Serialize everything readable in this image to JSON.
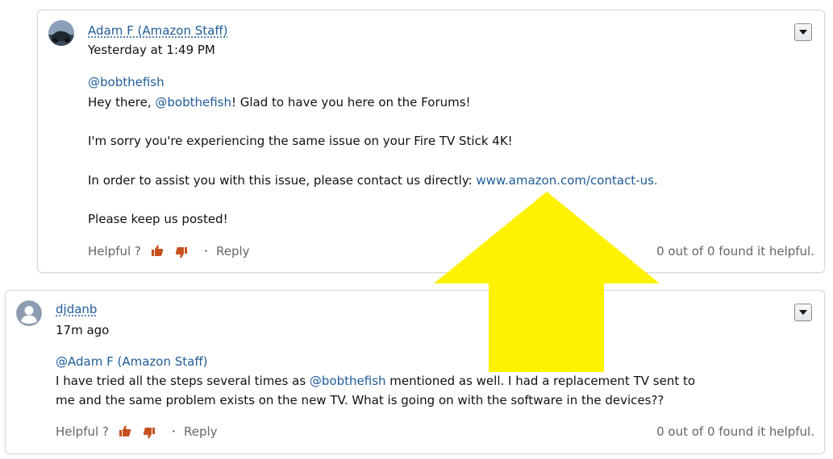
{
  "posts": [
    {
      "author": "Adam F (Amazon Staff)",
      "time": "Yesterday at 1:49 PM",
      "mention_line": "@bobthefish",
      "greeting_pre": "Hey there, ",
      "greeting_mention": "@bobthefish",
      "greeting_post": "! Glad to have you here on the Forums!",
      "sorry_line": "I'm sorry you're experiencing the same issue on your Fire TV Stick 4K!",
      "assist_pre": "In order to assist you with this issue, please contact us directly: ",
      "assist_link": "www.amazon.com/contact-us.",
      "closing": "Please keep us posted!",
      "helpful_label": "Helpful ?",
      "separator": "·",
      "reply_label": "Reply",
      "found_helpful": "0 out of 0 found it helpful."
    },
    {
      "author": "djdanb",
      "time": "17m ago",
      "mention_line": "@Adam F (Amazon Staff)",
      "body1_pre": "I have tried all the steps several times as ",
      "body1_mention": "@bobthefish",
      "body1_post": " mentioned as well. I had a replacement TV sent to",
      "body2": "me and the same problem exists on the new TV. What is going on with the software in the devices??",
      "helpful_label": "Helpful ?",
      "separator": "·",
      "reply_label": "Reply",
      "found_helpful": "0 out of 0 found it helpful."
    }
  ],
  "icons": {
    "thumb_up": "thumbs-up-icon",
    "thumb_down": "thumbs-down-icon",
    "menu": "dropdown-triangle-icon"
  },
  "colors": {
    "link": "#1f5c99",
    "thumb": "#c7511f",
    "annotation_arrow": "#fff200"
  }
}
